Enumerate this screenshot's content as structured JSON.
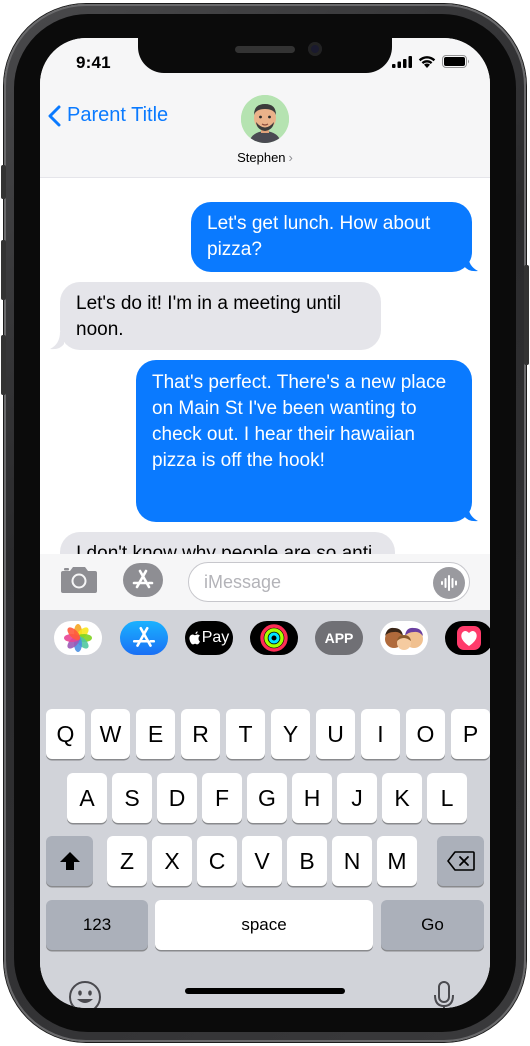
{
  "status_bar": {
    "time": "9:41"
  },
  "header": {
    "back_label": "Parent Title",
    "contact_name": "Stephen",
    "contact_chevron": "›"
  },
  "messages": [
    {
      "direction": "outgoing",
      "text": "Let's get lunch. How about pizza?"
    },
    {
      "direction": "incoming",
      "text": "Let's do it! I'm in a meeting until noon."
    },
    {
      "direction": "outgoing",
      "text": "That's perfect. There's a new place on Main St I've been wanting to check out. I hear their hawaiian pizza is off the hook!"
    },
    {
      "direction": "incoming",
      "text": "I don't know why people are so anti pineapple pizza. I kind of like it."
    }
  ],
  "input_bar": {
    "placeholder": "iMessage"
  },
  "app_drawer": {
    "apps": [
      {
        "name": "photos-app-icon"
      },
      {
        "name": "app-store-app-icon"
      },
      {
        "name": "apple-pay-app-icon",
        "label": "Pay"
      },
      {
        "name": "activity-app-icon"
      },
      {
        "name": "generic-app-icon",
        "label": "APP"
      },
      {
        "name": "memoji-app-icon"
      },
      {
        "name": "digital-touch-app-icon"
      }
    ]
  },
  "keyboard": {
    "row1": [
      "Q",
      "W",
      "E",
      "R",
      "T",
      "Y",
      "U",
      "I",
      "O",
      "P"
    ],
    "row2": [
      "A",
      "S",
      "D",
      "F",
      "G",
      "H",
      "J",
      "K",
      "L"
    ],
    "row3": [
      "Z",
      "X",
      "C",
      "V",
      "B",
      "N",
      "M"
    ],
    "numbers_label": "123",
    "space_label": "space",
    "go_label": "Go"
  },
  "colors": {
    "accent_blue": "#0a7aff",
    "incoming_bubble": "#e5e5ea",
    "keyboard_bg": "#d1d3d9",
    "avatar_bg": "#b5e3b1"
  }
}
